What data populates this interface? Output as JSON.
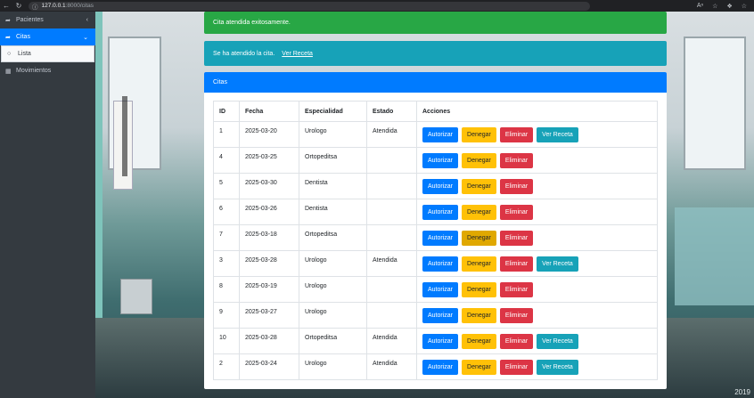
{
  "browser": {
    "url_host": "127.0.0.1",
    "url_path": ":8000/citas"
  },
  "sidebar": {
    "items": [
      {
        "label": "Pacientes",
        "icon": "share-icon"
      },
      {
        "label": "Citas",
        "icon": "share-icon"
      },
      {
        "label": "Lista",
        "icon": "circle-icon"
      },
      {
        "label": "Movimientos",
        "icon": "file-icon"
      }
    ]
  },
  "alerts": {
    "success": "Cita atendida exitosamente.",
    "info": "Se ha atendido la cita.",
    "info_link": "Ver Receta"
  },
  "card": {
    "title": "Citas",
    "columns": [
      "ID",
      "Fecha",
      "Especialidad",
      "Estado",
      "Acciones"
    ],
    "actions": {
      "authorize": "Autorizar",
      "deny": "Denegar",
      "delete": "Eliminar",
      "prescription": "Ver Receta"
    },
    "rows": [
      {
        "id": "1",
        "fecha": "2025-03-20",
        "especialidad": "Urologo",
        "estado": "Atendida",
        "receta": true
      },
      {
        "id": "4",
        "fecha": "2025-03-25",
        "especialidad": "Ortopeditsa",
        "estado": "",
        "receta": false
      },
      {
        "id": "5",
        "fecha": "2025-03-30",
        "especialidad": "Dentista",
        "estado": "",
        "receta": false
      },
      {
        "id": "6",
        "fecha": "2025-03-26",
        "especialidad": "Dentista",
        "estado": "",
        "receta": false
      },
      {
        "id": "7",
        "fecha": "2025-03-18",
        "especialidad": "Ortopeditsa",
        "estado": "",
        "receta": false
      },
      {
        "id": "3",
        "fecha": "2025-03-28",
        "especialidad": "Urologo",
        "estado": "Atendida",
        "receta": true
      },
      {
        "id": "8",
        "fecha": "2025-03-19",
        "especialidad": "Urologo",
        "estado": "",
        "receta": false
      },
      {
        "id": "9",
        "fecha": "2025-03-27",
        "especialidad": "Urologo",
        "estado": "",
        "receta": false
      },
      {
        "id": "10",
        "fecha": "2025-03-28",
        "especialidad": "Ortopeditsa",
        "estado": "Atendida",
        "receta": true
      },
      {
        "id": "2",
        "fecha": "2025-03-24",
        "especialidad": "Urologo",
        "estado": "Atendida",
        "receta": true
      }
    ]
  },
  "background": {
    "sign_text": "2019"
  },
  "colors": {
    "primary": "#007bff",
    "success": "#28a745",
    "info": "#17a2b8",
    "warning": "#ffc107",
    "danger": "#dc3545",
    "sidebar": "#343a40"
  }
}
